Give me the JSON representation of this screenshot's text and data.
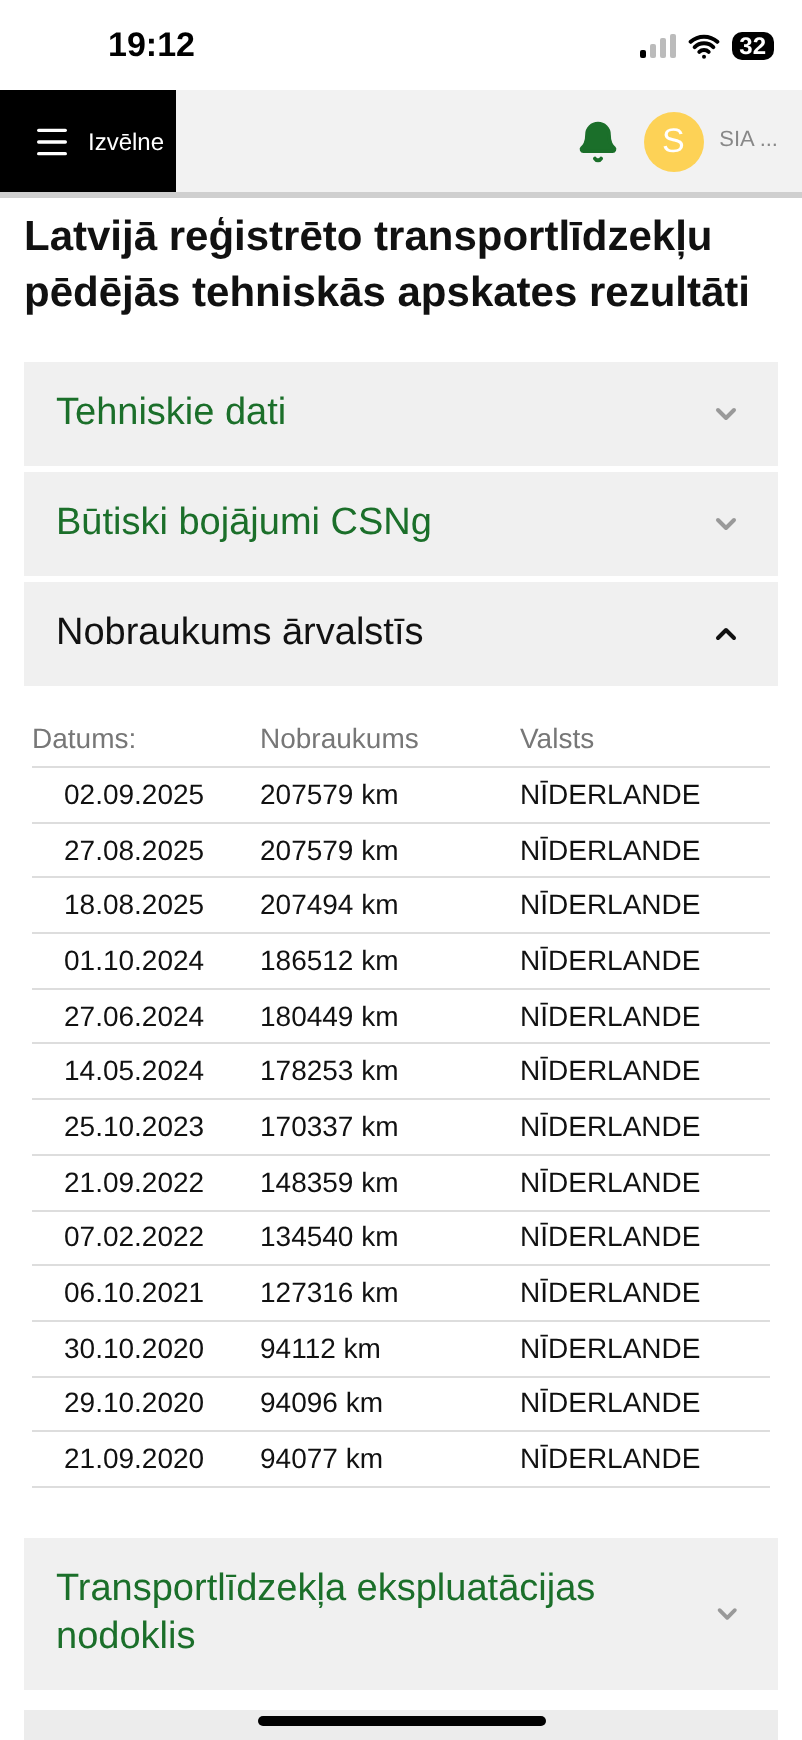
{
  "status_bar": {
    "time": "19:12",
    "battery": "32"
  },
  "header": {
    "menu_label": "Izvēlne",
    "avatar_letter": "S",
    "account": "SIA ..."
  },
  "title": "Latvijā reģistrēto transportlīdzekļu pēdējās tehniskās apskates rezultāti",
  "sections": [
    {
      "title": "Tehniskie dati",
      "expanded": false
    },
    {
      "title": "Būtiski bojājumi CSNg",
      "expanded": false
    },
    {
      "title": "Nobraukums ārvalstīs",
      "expanded": true,
      "table": {
        "columns": [
          "Datums:",
          "Nobraukums",
          "Valsts"
        ],
        "rows": [
          [
            "02.09.2025",
            "207579 km",
            "NĪDERLANDE"
          ],
          [
            "27.08.2025",
            "207579 km",
            "NĪDERLANDE"
          ],
          [
            "18.08.2025",
            "207494 km",
            "NĪDERLANDE"
          ],
          [
            "01.10.2024",
            "186512 km",
            "NĪDERLANDE"
          ],
          [
            "27.06.2024",
            "180449 km",
            "NĪDERLANDE"
          ],
          [
            "14.05.2024",
            "178253 km",
            "NĪDERLANDE"
          ],
          [
            "25.10.2023",
            "170337 km",
            "NĪDERLANDE"
          ],
          [
            "21.09.2022",
            "148359 km",
            "NĪDERLANDE"
          ],
          [
            "07.02.2022",
            "134540 km",
            "NĪDERLANDE"
          ],
          [
            "06.10.2021",
            "127316 km",
            "NĪDERLANDE"
          ],
          [
            "30.10.2020",
            "94112 km",
            "NĪDERLANDE"
          ],
          [
            "29.10.2020",
            "94096 km",
            "NĪDERLANDE"
          ],
          [
            "21.09.2020",
            "94077 km",
            "NĪDERLANDE"
          ]
        ]
      }
    },
    {
      "title": "Transportlīdzekļa ekspluatācijas nodoklis",
      "expanded": false
    }
  ]
}
